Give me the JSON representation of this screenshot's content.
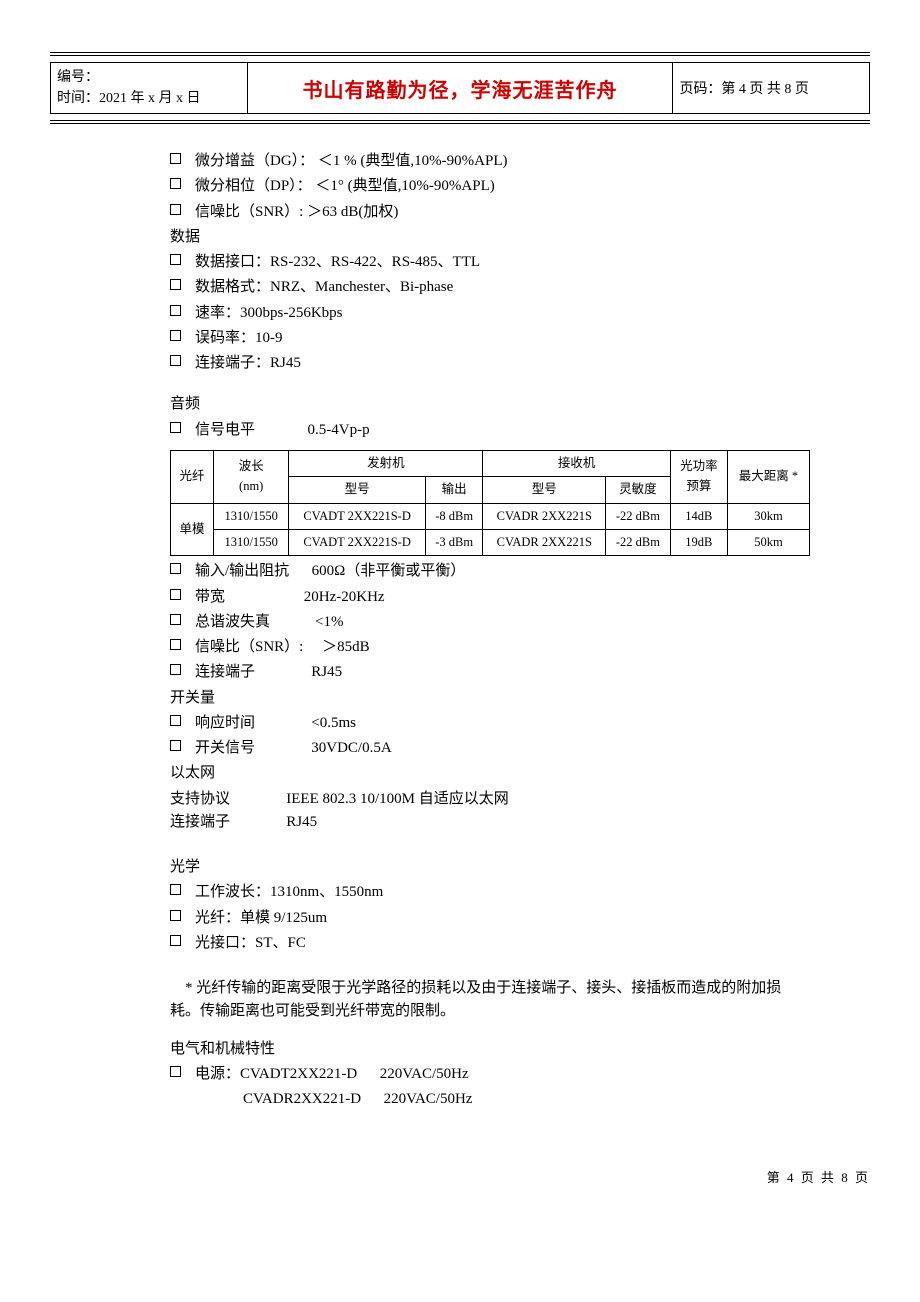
{
  "header": {
    "number_label": "编号：",
    "time_label": "时间：2021 年 x 月 x 日",
    "center": "书山有路勤为径，学海无涯苦作舟",
    "pagecode": "页码：第 4 页 共 8 页"
  },
  "video": {
    "dg": "微分增益（DG）：    ＜1 % (典型值,10%-90%APL)",
    "dp": "微分相位（DP）：    ＜1°   (典型值,10%-90%APL)",
    "snr": "信噪比（SNR）:           ＞63 dB(加权)"
  },
  "data_sec": {
    "title": "数据",
    "iface": "数据接口：RS-232、RS-422、RS-485、TTL",
    "fmt": "数据格式：NRZ、Manchester、Bi-phase",
    "rate": "速率：300bps-256Kbps",
    "ber": "误码率：10-9",
    "conn": "连接端子：RJ45"
  },
  "audio": {
    "title": "音频",
    "level": "信号电平              0.5-4Vp-p"
  },
  "table": {
    "h_fiber": "光纤",
    "h_wave": "波长(nm)",
    "h_wave_top": "波长",
    "h_wave_bot": "(nm)",
    "h_tx": "发射机",
    "h_rx": "接收机",
    "h_model": "型号",
    "h_out": "输出",
    "h_sens": "灵敏度",
    "h_budget_top": "光功率",
    "h_budget_bot": "预算",
    "h_maxdist": "最大距离 *",
    "row1": {
      "fiber": "单模",
      "wave": "1310/1550",
      "txmodel": "CVADT 2XX221S-D",
      "txout": "-8 dBm",
      "rxmodel": "CVADR 2XX221S",
      "rxsens": "-22 dBm",
      "budget": "14dB",
      "dist": "30km"
    },
    "row2": {
      "wave": "1310/1550",
      "txmodel": "CVADT 2XX221S-D",
      "txout": "-3 dBm",
      "rxmodel": "CVADR 2XX221S",
      "rxsens": "-22 dBm",
      "budget": "19dB",
      "dist": "50km"
    }
  },
  "audio2": {
    "imp": "输入/输出阻抗      600Ω（非平衡或平衡）",
    "bw": "带宽                     20Hz-20KHz",
    "thd": "总谐波失真            <1%",
    "snr": "信噪比（SNR）:     ＞85dB",
    "conn": "连接端子               RJ45"
  },
  "switch": {
    "title": "开关量",
    "resp": "响应时间               <0.5ms",
    "sig": "开关信号               30VDC/0.5A"
  },
  "eth": {
    "title": "以太网",
    "proto": "支持协议               IEEE 802.3 10/100M 自适应以太网",
    "conn": "连接端子               RJ45"
  },
  "optics": {
    "title": "光学",
    "wl": "工作波长：1310nm、1550nm",
    "fib": "光纤：单模 9/125um",
    "port": "光接口：ST、FC"
  },
  "note": "* 光纤传输的距离受限于光学路径的损耗以及由于连接端子、接头、接插板而造成的附加损耗。传输距离也可能受到光纤带宽的限制。",
  "elec": {
    "title": "电气和机械特性",
    "pwr1": "电源：CVADT2XX221-D      220VAC/50Hz",
    "pwr2": "            CVADR2XX221-D      220VAC/50Hz"
  },
  "footer": "第 4 页 共 8 页"
}
